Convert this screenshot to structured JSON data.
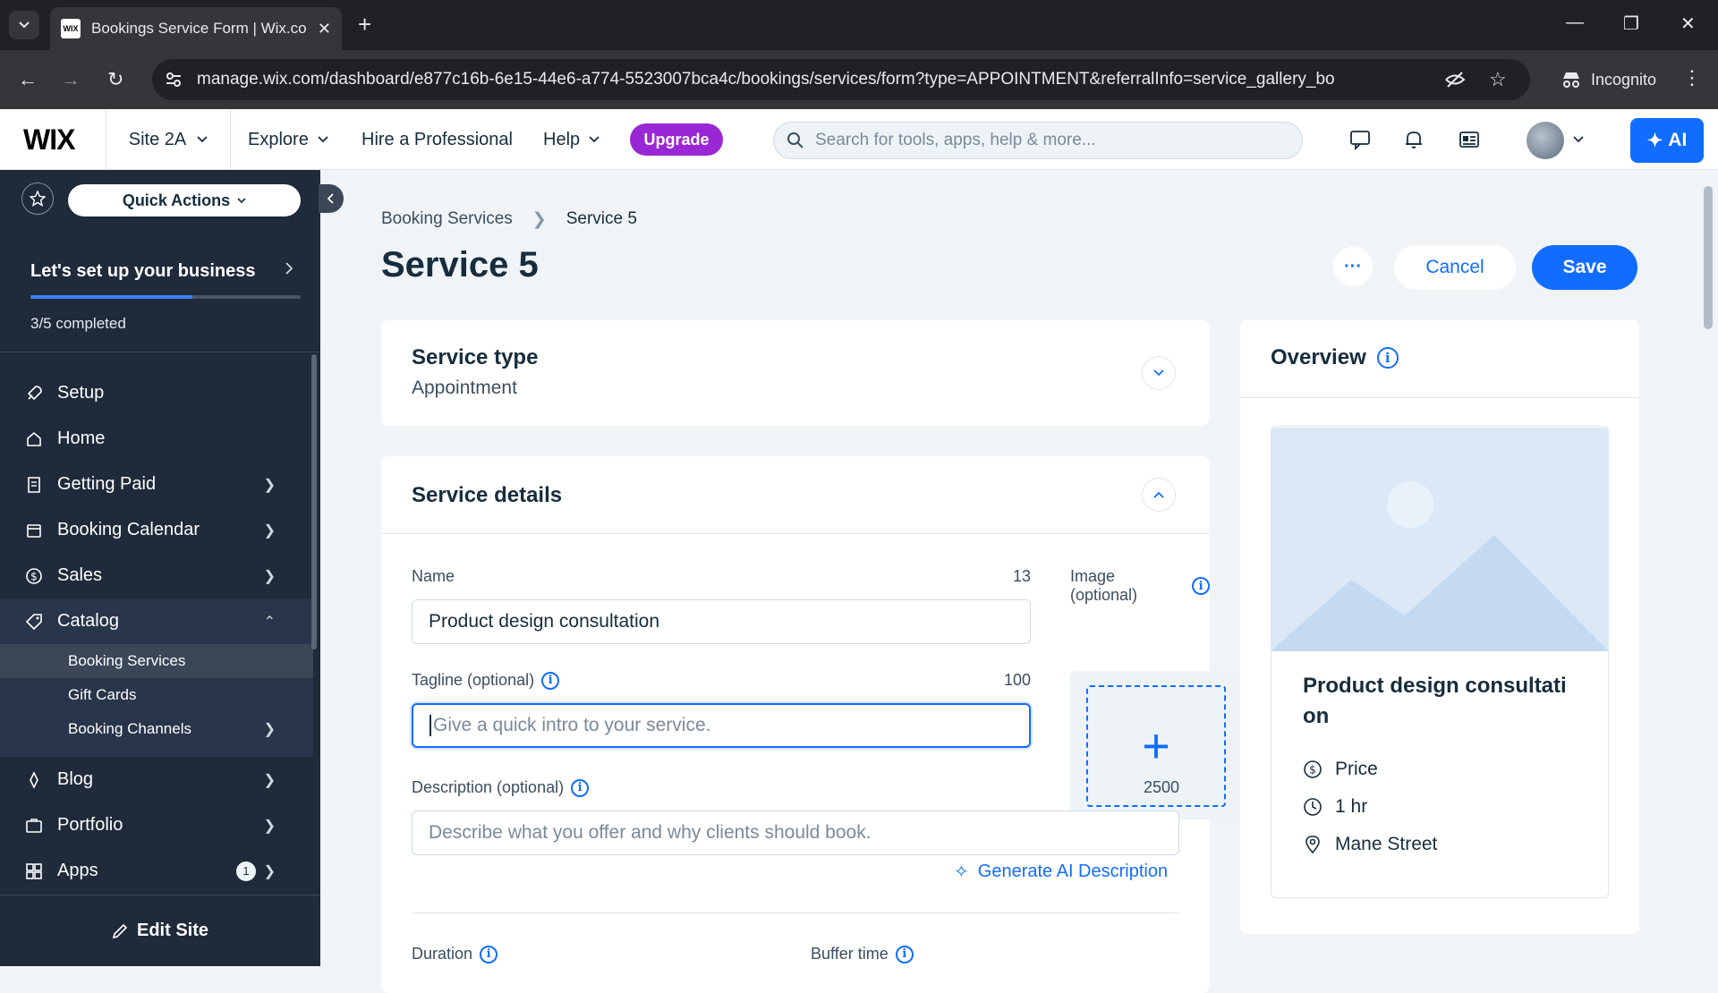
{
  "browser": {
    "tab_title": "Bookings Service Form | Wix.com",
    "favicon_text": "WIX",
    "url": "manage.wix.com/dashboard/e877c16b-6e15-44e6-a774-5523007bca4c/bookings/services/form?type=APPOINTMENT&referralInfo=service_gallery_bo",
    "incognito_label": "Incognito"
  },
  "topbar": {
    "logo": "WIX",
    "site_name": "Site 2A",
    "nav": [
      "Explore",
      "Hire a Professional",
      "Help"
    ],
    "upgrade_label": "Upgrade",
    "search_placeholder": "Search for tools, apps, help & more...",
    "ai_label": "AI"
  },
  "sidebar": {
    "quick_actions_label": "Quick Actions",
    "setup_title": "Let's set up your business",
    "setup_progress": 0.6,
    "setup_count": "3/5 completed",
    "items": [
      {
        "label": "Setup",
        "icon": "rocket-icon",
        "chevron": false
      },
      {
        "label": "Home",
        "icon": "home-icon",
        "chevron": false
      },
      {
        "label": "Getting Paid",
        "icon": "receipt-icon",
        "chevron": true
      },
      {
        "label": "Booking Calendar",
        "icon": "calendar-icon",
        "chevron": true
      },
      {
        "label": "Sales",
        "icon": "dollar-icon",
        "chevron": true
      },
      {
        "label": "Catalog",
        "icon": "tag-icon",
        "chevron": "up"
      }
    ],
    "catalog_sub": [
      "Booking Services",
      "Gift Cards",
      "Booking Channels"
    ],
    "items_after": [
      {
        "label": "Blog",
        "icon": "pen-icon"
      },
      {
        "label": "Portfolio",
        "icon": "portfolio-icon"
      },
      {
        "label": "Apps",
        "icon": "apps-icon",
        "badge": "1"
      }
    ],
    "edit_site_label": "Edit Site"
  },
  "page": {
    "breadcrumb": [
      "Booking Services",
      "Service 5"
    ],
    "title": "Service 5",
    "more_label": "···",
    "cancel_label": "Cancel",
    "save_label": "Save"
  },
  "service_type": {
    "heading": "Service type",
    "value": "Appointment"
  },
  "service_details": {
    "heading": "Service details",
    "name_label": "Name",
    "name_counter": "13",
    "name_value": "Product design consultation",
    "image_label": "Image (optional)",
    "tagline_label": "Tagline (optional)",
    "tagline_counter": "100",
    "tagline_placeholder": "Give a quick intro to your service.",
    "description_label": "Description (optional)",
    "description_counter": "2500",
    "description_placeholder": "Describe what you offer and why clients should book.",
    "ai_description_label": "Generate AI Description",
    "duration_label": "Duration",
    "buffer_label": "Buffer time"
  },
  "overview": {
    "heading": "Overview",
    "service_name_line1": "Product design consultati",
    "service_name_line2": "on",
    "price_label": "Price",
    "duration": "1 hr",
    "location": "Mane Street"
  },
  "colors": {
    "accent": "#116dff",
    "upgrade": "#9a27d5",
    "sidebar_bg": "#1f2a3a"
  }
}
